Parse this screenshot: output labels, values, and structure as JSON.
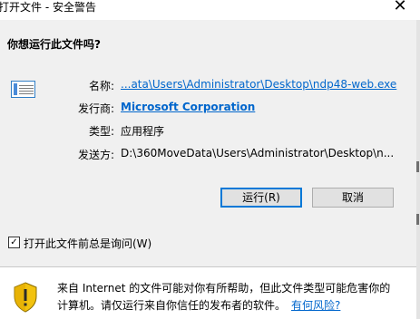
{
  "window": {
    "title": "打开文件 - 安全警告",
    "close_glyph": "✕"
  },
  "question": "你想运行此文件吗?",
  "details": {
    "name_label": "名称:",
    "name_value": "...ata\\Users\\Administrator\\Desktop\\ndp48-web.exe",
    "publisher_label": "发行商:",
    "publisher_value": "Microsoft Corporation",
    "type_label": "类型:",
    "type_value": "应用程序",
    "from_label": "发送方:",
    "from_value": "D:\\360MoveData\\Users\\Administrator\\Desktop\\n..."
  },
  "buttons": {
    "run_label": "运行(R)",
    "cancel_label": "取消"
  },
  "checkbox": {
    "checked": true,
    "check_glyph": "✓",
    "label": "打开此文件前总是询问(W)"
  },
  "warning": {
    "text_line1": "来自 Internet 的文件可能对你有所帮助，但此文件类型可能危害你的",
    "text_line2": "计算机。请仅运行来自你信任的发布者的软件。",
    "risk_link": "有何风险?"
  },
  "colors": {
    "link": "#0066cc",
    "primary_border": "#0078d7",
    "shield_yellow": "#f2c20f"
  },
  "icons": {
    "app": "application-window-icon",
    "footer": "security-warning-shield-icon"
  }
}
